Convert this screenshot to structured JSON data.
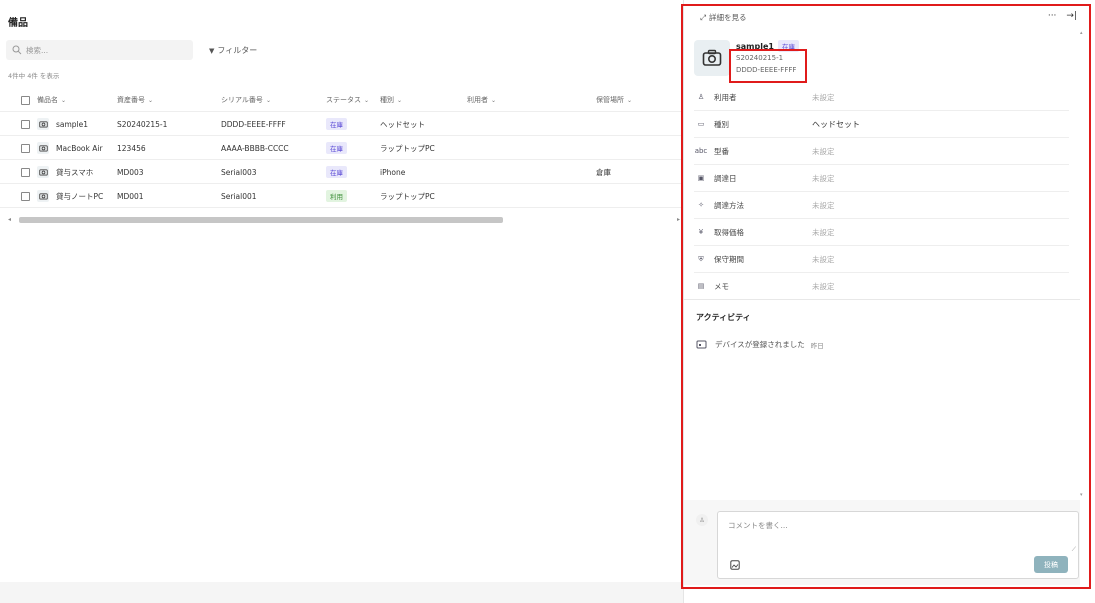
{
  "list": {
    "title": "備品",
    "search_placeholder": "検索...",
    "filter_label": "フィルター",
    "count_text": "4件中 4件 を表示",
    "columns": [
      "備品名",
      "資産番号",
      "シリアル番号",
      "ステータス",
      "種別",
      "利用者",
      "保管場所"
    ],
    "rows": [
      {
        "name": "sample1",
        "asset": "S20240215-1",
        "serial": "DDDD-EEEE-FFFF",
        "status": "在庫",
        "status_type": "stock",
        "kind": "ヘッドセット",
        "user": "",
        "location": ""
      },
      {
        "name": "MacBook Air",
        "asset": "123456",
        "serial": "AAAA-BBBB-CCCC",
        "status": "在庫",
        "status_type": "stock",
        "kind": "ラップトップPC",
        "user": "",
        "location": ""
      },
      {
        "name": "貸与スマホ",
        "asset": "MD003",
        "serial": "Serial003",
        "status": "在庫",
        "status_type": "stock",
        "kind": "iPhone",
        "user": "",
        "location": "倉庫"
      },
      {
        "name": "貸与ノートPC",
        "asset": "MD001",
        "serial": "Serial001",
        "status": "利用",
        "status_type": "use",
        "kind": "ラップトップPC",
        "user": "",
        "location": ""
      }
    ]
  },
  "panel": {
    "view_details": "詳細を見る",
    "more": "···",
    "collapse": "→|",
    "name": "sample1",
    "status": "在庫",
    "asset_number": "S20240215-1",
    "serial_number": "DDDD-EEEE-FFFF",
    "properties": [
      {
        "label": "利用者",
        "value": "未設定",
        "icon": "user-icon",
        "glyph": "♙",
        "filled": false
      },
      {
        "label": "種別",
        "value": "ヘッドセット",
        "icon": "device-icon",
        "glyph": "▭",
        "filled": true
      },
      {
        "label": "型番",
        "value": "未設定",
        "icon": "model-icon",
        "glyph": "abc",
        "filled": false
      },
      {
        "label": "調達日",
        "value": "未設定",
        "icon": "calendar-icon",
        "glyph": "▣",
        "filled": false
      },
      {
        "label": "調達方法",
        "value": "未設定",
        "icon": "sparkle-icon",
        "glyph": "✧",
        "filled": false
      },
      {
        "label": "取得価格",
        "value": "未設定",
        "icon": "yen-icon",
        "glyph": "¥",
        "filled": false
      },
      {
        "label": "保守期間",
        "value": "未設定",
        "icon": "shield-icon",
        "glyph": "⛨",
        "filled": false
      },
      {
        "label": "メモ",
        "value": "未設定",
        "icon": "memo-icon",
        "glyph": "▤",
        "filled": false
      }
    ],
    "activity_title": "アクティビティ",
    "activity": [
      {
        "text": "デバイスが登録されました",
        "when": "昨日"
      }
    ],
    "comment_placeholder": "コメントを書く...",
    "post_label": "投稿"
  },
  "colors": {
    "highlight": "#e01b1b",
    "status_stock_bg": "#e9e8fb",
    "status_use_bg": "#e2f4e0",
    "post_button": "#8fb3bd"
  }
}
